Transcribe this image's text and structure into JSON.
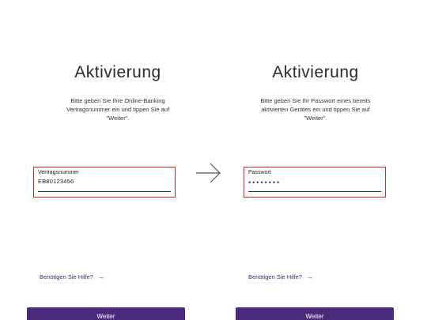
{
  "screens": [
    {
      "title": "Aktivierung",
      "description": [
        "Bitte geben Sie Ihre Online-Banking",
        "Vertragsnummer ein und tippen Sie auf",
        "\"Weiter\"."
      ],
      "field": {
        "label": "Vertragsnummer",
        "value": "EB80123456"
      },
      "help_link": "Benötigen Sie Hilfe?",
      "help_arrow": "→",
      "button": "Weiter"
    },
    {
      "title": "Aktivierung",
      "description": [
        "Bitte geben Sie Ihr Passwort eines bereits",
        "aktivierten Gerätes ein und tippen Sie auf",
        "\"Weiter\"."
      ],
      "field": {
        "label": "Passwort",
        "masked_value": "••••••••"
      },
      "help_link": "Benötigen Sie Hilfe?",
      "help_arrow": "→",
      "button": "Weiter"
    }
  ],
  "colors": {
    "accent": "#4b2a7b",
    "highlight": "#e02424",
    "text": "#2a2a2a"
  },
  "icons": {
    "transition": "arrow-right-icon"
  }
}
